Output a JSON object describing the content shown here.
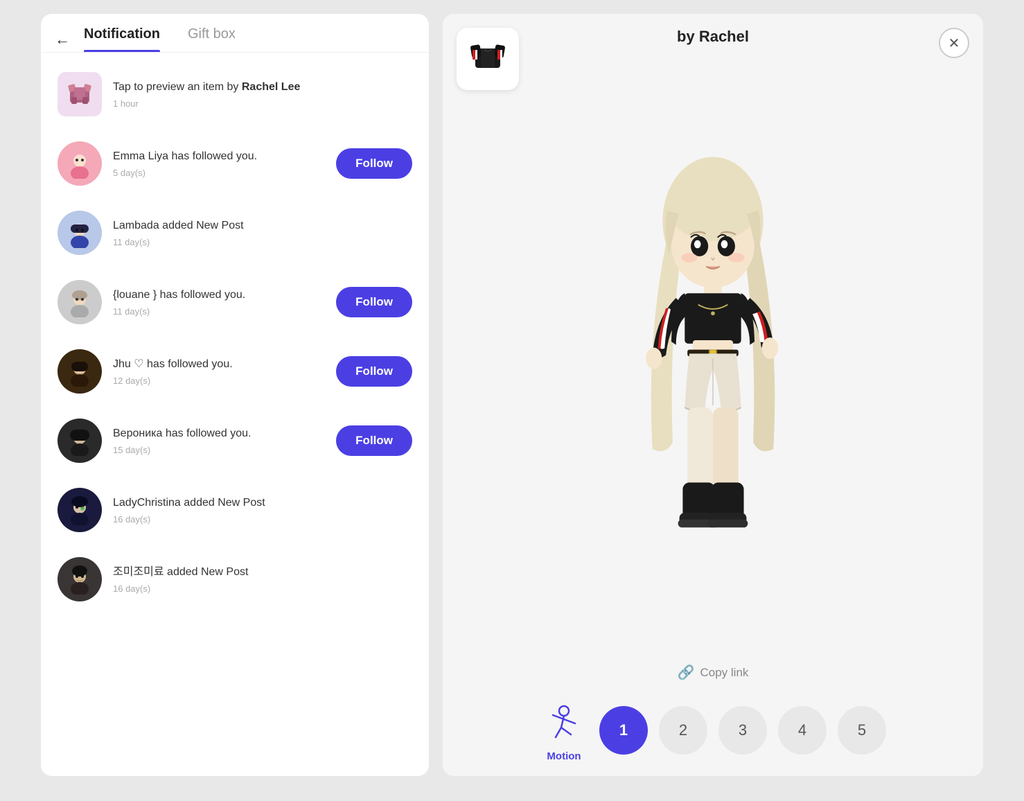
{
  "left": {
    "back_label": "←",
    "tabs": [
      {
        "id": "notification",
        "label": "Notification",
        "active": true
      },
      {
        "id": "giftbox",
        "label": "Gift box",
        "active": false
      }
    ],
    "notifications": [
      {
        "id": "notif1",
        "avatar_type": "clothing",
        "avatar_bg": "#f0e0f0",
        "avatar_icon": "👗",
        "text": "Tap to preview an item by ",
        "bold": "Rachel Lee",
        "time": "1 hour",
        "has_follow": false
      },
      {
        "id": "notif2",
        "avatar_type": "circle",
        "avatar_bg": "#f4b0c0",
        "avatar_icon": "🧑",
        "text": "Emma Liya has followed you.",
        "bold": "",
        "time": "5 day(s)",
        "has_follow": true,
        "follow_label": "Follow"
      },
      {
        "id": "notif3",
        "avatar_type": "circle",
        "avatar_bg": "#b0c4e8",
        "avatar_icon": "👤",
        "text": "Lambada added New Post",
        "bold": "",
        "time": "11 day(s)",
        "has_follow": false
      },
      {
        "id": "notif4",
        "avatar_type": "circle",
        "avatar_bg": "#cccccc",
        "avatar_icon": "🧑",
        "text": "{louane } has followed you.",
        "bold": "",
        "time": "11 day(s)",
        "has_follow": true,
        "follow_label": "Follow"
      },
      {
        "id": "notif5",
        "avatar_type": "circle",
        "avatar_bg": "#5a3820",
        "avatar_icon": "🧑",
        "text": "Jhu ♡ has followed you.",
        "bold": "",
        "time": "12 day(s)",
        "has_follow": true,
        "follow_label": "Follow"
      },
      {
        "id": "notif6",
        "avatar_type": "circle",
        "avatar_bg": "#2a2a2a",
        "avatar_icon": "🧑",
        "text": "Вероника has followed you.",
        "bold": "",
        "time": "15 day(s)",
        "has_follow": true,
        "follow_label": "Follow"
      },
      {
        "id": "notif7",
        "avatar_type": "circle",
        "avatar_bg": "#1a1a3e",
        "avatar_icon": "🧑",
        "text": "LadyChristina added New Post",
        "bold": "",
        "time": "16 day(s)",
        "has_follow": false
      },
      {
        "id": "notif8",
        "avatar_type": "circle",
        "avatar_bg": "#3a3535",
        "avatar_icon": "🧑",
        "text": "조미조미료 added New Post",
        "bold": "",
        "time": "16 day(s)",
        "has_follow": false
      }
    ]
  },
  "right": {
    "title": "by Rachel",
    "close_label": "✕",
    "item_icon": "🧥",
    "copy_link_label": "Copy link",
    "motion_label": "Motion",
    "motion_numbers": [
      "1",
      "2",
      "3",
      "4",
      "5"
    ],
    "active_motion": 1
  }
}
